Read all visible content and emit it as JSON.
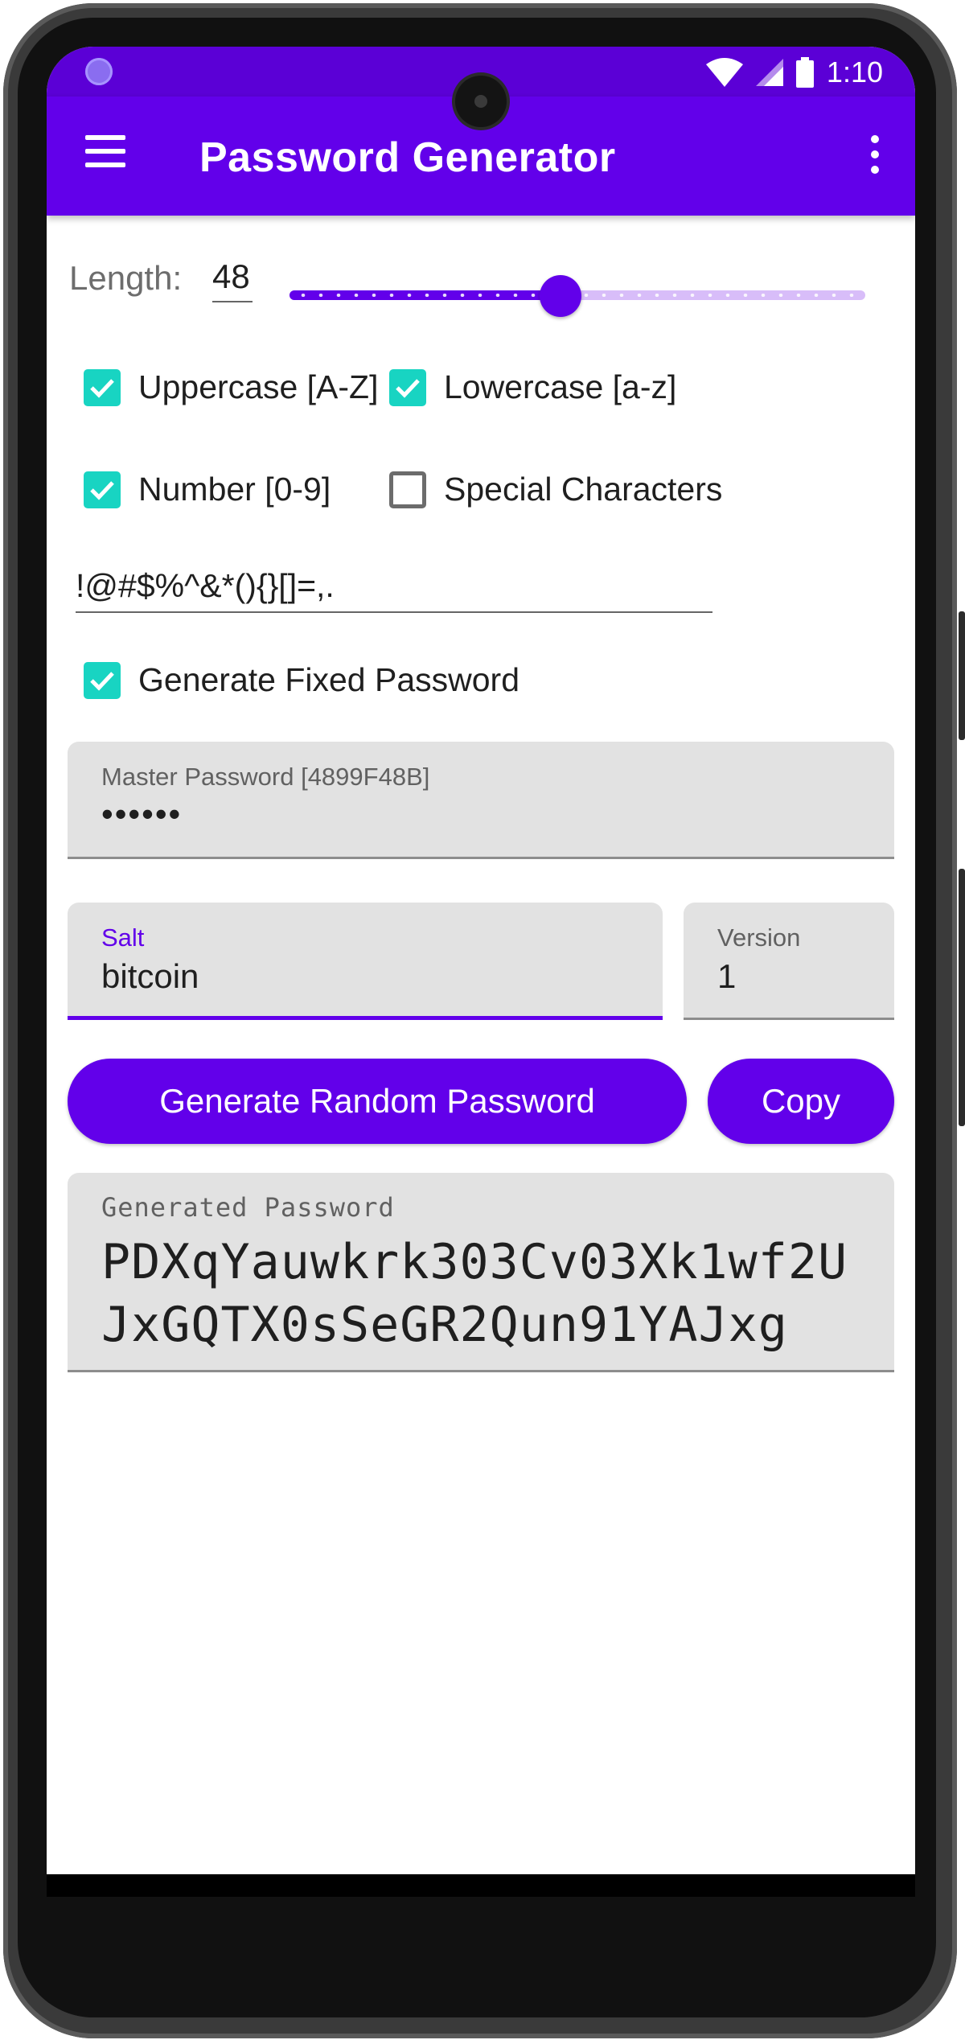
{
  "status_bar": {
    "time": "1:10",
    "icons": [
      "notification-dot-icon",
      "wifi-icon",
      "signal-icon",
      "battery-icon"
    ]
  },
  "app_bar": {
    "title": "Password Generator",
    "menu_icon": "hamburger-menu-icon",
    "overflow_icon": "more-vert-icon"
  },
  "length": {
    "label": "Length:",
    "value": "48",
    "slider_fraction": 0.47
  },
  "options": {
    "uppercase": {
      "label": "Uppercase [A-Z]",
      "checked": true
    },
    "lowercase": {
      "label": "Lowercase [a-z]",
      "checked": true
    },
    "number": {
      "label": "Number [0-9]",
      "checked": true
    },
    "special": {
      "label": "Special Characters",
      "checked": false
    },
    "special_chars_value": "!@#$%^&*(){}[]=,.",
    "fixed": {
      "label": "Generate Fixed Password",
      "checked": true
    }
  },
  "master_password": {
    "label": "Master Password [4899F48B]",
    "value": "••••••"
  },
  "salt": {
    "label": "Salt",
    "value": "bitcoin"
  },
  "version": {
    "label": "Version",
    "value": "1"
  },
  "buttons": {
    "generate": "Generate Random Password",
    "copy": "Copy"
  },
  "generated": {
    "label": "Generated Password",
    "value": "PDXqYauwkrk303Cv03Xk1wf2UJxGQTX0sSeGR2Qun91YAJxg"
  },
  "colors": {
    "status_bar": "#5b00d6",
    "app_bar": "#6200ea",
    "checkbox": "#18d4c2",
    "field_bg": "#e2e2e2"
  },
  "navigation": {
    "icons": [
      "back-icon",
      "home-icon",
      "recents-icon"
    ]
  }
}
